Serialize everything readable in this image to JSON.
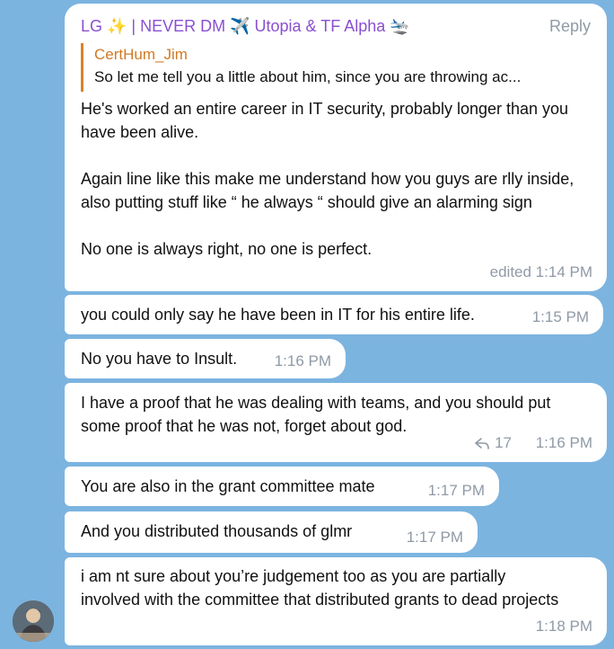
{
  "messages": [
    {
      "sender": "LG ✨ | NEVER DM ✈️ Utopia & TF Alpha 🛬",
      "reply_label": "Reply",
      "quote": {
        "name": "CertHum_Jim",
        "text": "So let me tell you a little about him, since you are throwing ac..."
      },
      "text": "He's worked an entire career in IT security, probably longer than you have been alive.\n\nAgain line like this make me understand how you guys are rlly inside, also putting stuff like “ he always “ should give an alarming sign\n\nNo one is always right, no one is perfect.",
      "time": "edited 1:14 PM"
    },
    {
      "text": "you could only say he have been in IT for his entire life.",
      "time": "1:15 PM"
    },
    {
      "text": "No you have to Insult.",
      "time": "1:16 PM"
    },
    {
      "text": "I have a proof that he was dealing with teams, and you should put some proof that he was not, forget about god.",
      "forwards": "17",
      "time": "1:16 PM"
    },
    {
      "text": "You are also in the grant committee mate",
      "time": "1:17 PM"
    },
    {
      "text": "And you distributed thousands of glmr",
      "time": "1:17 PM"
    },
    {
      "text": "i am nt sure about you’re judgement too as you are partially involved with the committee that distributed grants to dead projects",
      "time": "1:18 PM"
    }
  ],
  "colors": {
    "background": "#7cb4e0",
    "bubble": "#ffffff",
    "sender": "#8a4fd1",
    "quote_accent": "#d07a24",
    "meta": "#8f9aa6"
  },
  "icons": [
    "forward-arrow-icon",
    "avatar"
  ]
}
